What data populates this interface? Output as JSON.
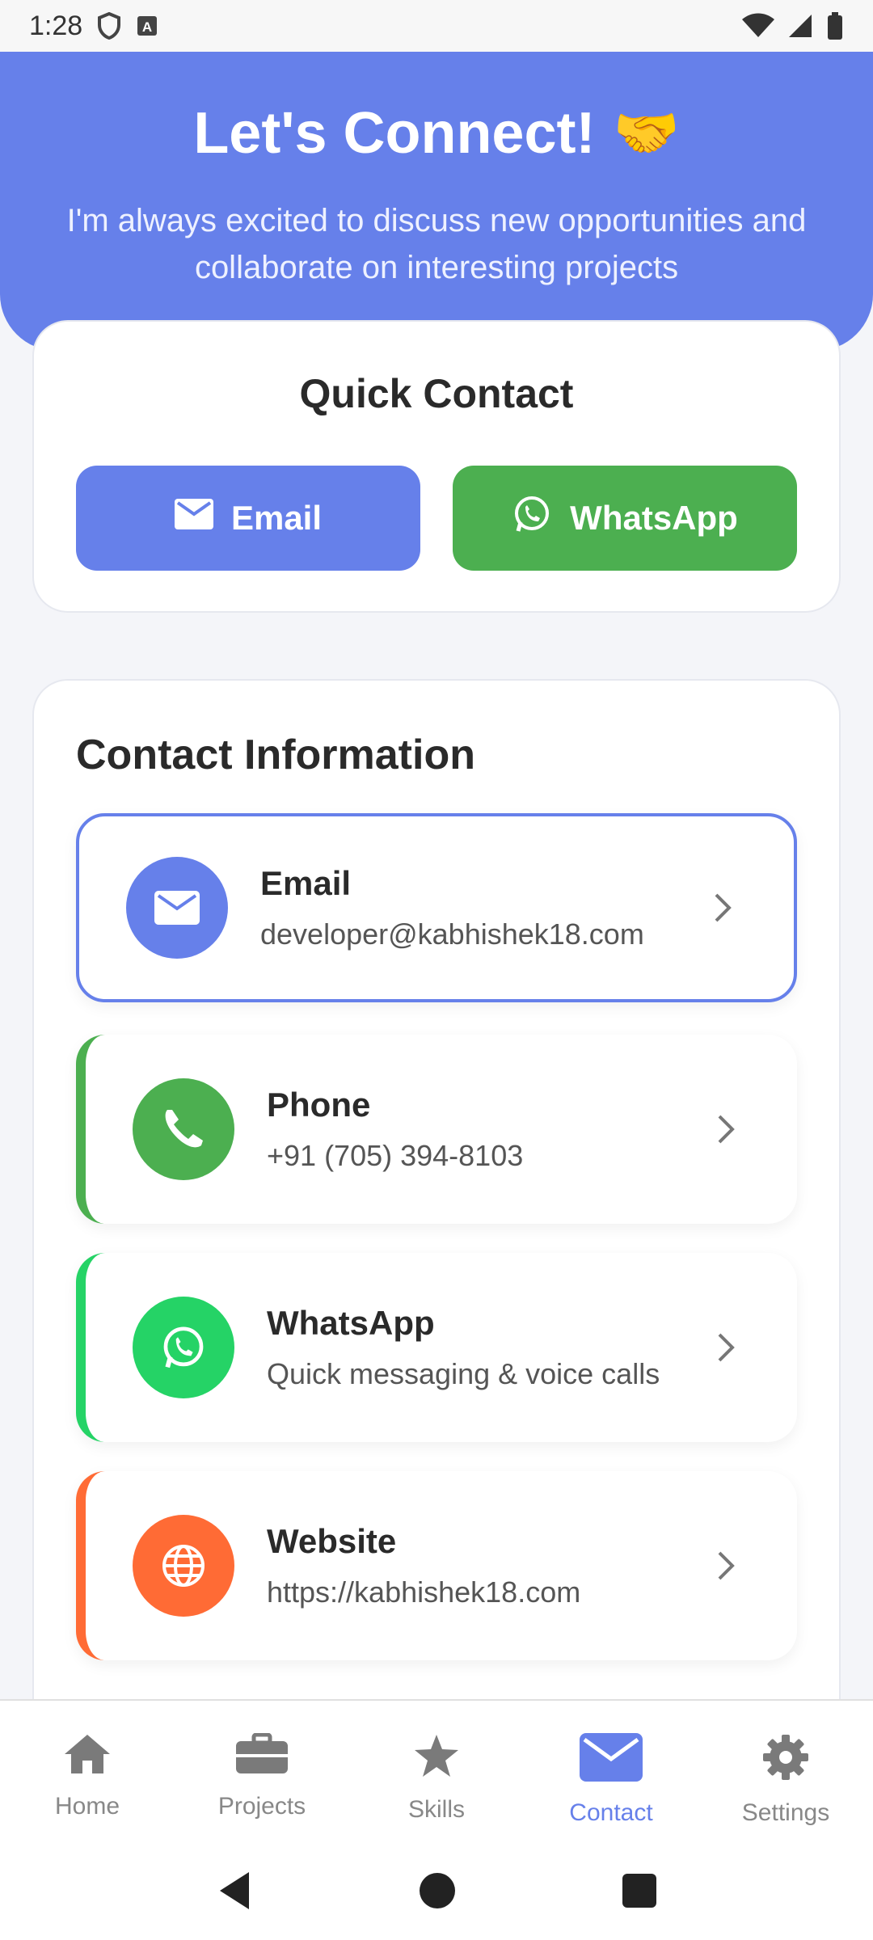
{
  "status_bar": {
    "time": "1:28"
  },
  "hero": {
    "title": "Let's Connect!",
    "emoji": "🤝",
    "subtitle": "I'm always excited to discuss new opportunities and collaborate on interesting projects"
  },
  "quick_contact": {
    "title": "Quick Contact",
    "email_label": "Email",
    "whatsapp_label": "WhatsApp"
  },
  "contact_info": {
    "title": "Contact Information",
    "items": [
      {
        "label": "Email",
        "value": "developer@kabhishek18.com",
        "color": "#6680ea",
        "icon": "mail-icon"
      },
      {
        "label": "Phone",
        "value": "+91 (705) 394-8103",
        "color": "#4caf50",
        "icon": "phone-icon"
      },
      {
        "label": "WhatsApp",
        "value": "Quick messaging & voice calls",
        "color": "#25d366",
        "icon": "whatsapp-icon"
      },
      {
        "label": "Website",
        "value": "https://kabhishek18.com",
        "color": "#ff6b35",
        "icon": "globe-icon"
      }
    ]
  },
  "bottom_nav": {
    "items": [
      {
        "label": "Home",
        "icon": "home-icon"
      },
      {
        "label": "Projects",
        "icon": "briefcase-icon"
      },
      {
        "label": "Skills",
        "icon": "star-icon"
      },
      {
        "label": "Contact",
        "icon": "envelope-icon",
        "active": true
      },
      {
        "label": "Settings",
        "icon": "gear-icon"
      }
    ]
  },
  "colors": {
    "accent": "#6680ea",
    "whatsapp_green": "#4caf50"
  }
}
